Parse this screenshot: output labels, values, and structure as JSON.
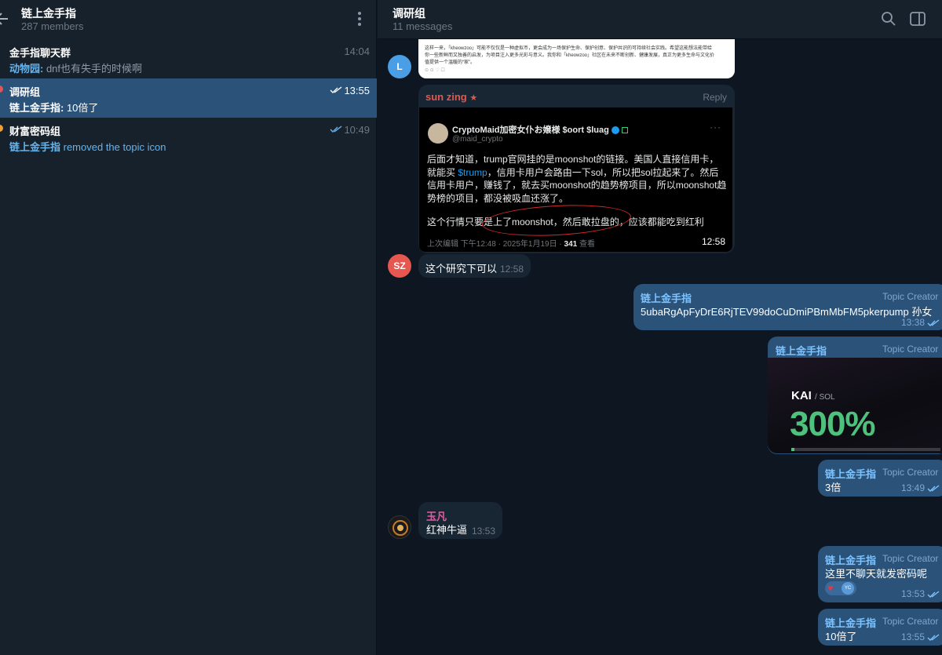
{
  "left": {
    "header": {
      "title": "链上金手指",
      "members": "287 members"
    },
    "topics": [
      {
        "name": "金手指聊天群",
        "sender": "动物园:",
        "message": " dnf也有失手的时候啊",
        "time": "14:04",
        "checks": false,
        "dot": ""
      },
      {
        "name": "调研组",
        "sender": "链上金手指:",
        "message": " 10倍了",
        "time": "13:55",
        "checks": true,
        "dot": "#e05656"
      },
      {
        "name": "财富密码组",
        "sender": "链上金手指",
        "message": " removed the topic icon",
        "time": "10:49",
        "checks": true,
        "dot": "#f0a030"
      }
    ]
  },
  "chat": {
    "header": {
      "title": "调研组",
      "count": "11 messages"
    },
    "top_image": {
      "lines": [
        "这样一来，「kheowzoo」可能不仅仅是一种虚拟币，更会成为一场保护生命、保护创意、保护共识的可持续社会实践。希望这能想法能带给",
        "你一些新鲜而又独善的启发，为项目注入更多光彩与意义。我你和「kheowzoo」社区在未来不断创新、健康发展，真正为更多生命与文化价",
        "值提供一个温暖的“家”。"
      ],
      "avatar": "L"
    },
    "tweet_msg": {
      "sender": "sun zing",
      "reply": "Reply",
      "tweet_author": "CryptoMaid加密女仆お嬢様 $oort $luag",
      "tweet_handle": "@maid_crypto",
      "body_pre": "后面才知道，trump官网挂的是moonshot的链接。美国人直接信用卡，就能买 ",
      "body_link": "$trump",
      "body_post": "，信用卡用户会路由一下sol，所以把sol拉起来了。然后信用卡用户，赚钱了，就去买moonshot的趋势榜项目，所以moonshot趋势榜的项目，都没被吸血还涨了。",
      "body_line2": "这个行情只要是上了moonshot，然后敢拉盘的，应该都能吃到红利",
      "meta_pre": "上次编辑 下午12:48 · 2025年1月19日 · ",
      "meta_views": "341",
      "meta_post": " 查看",
      "time": "12:58"
    },
    "sz_msg": {
      "avatar": "SZ",
      "text": "这个研究下可以",
      "time": "12:58"
    },
    "out1": {
      "sender": "链上金手指",
      "role": "Topic Creator",
      "text": "5ubaRgApFyDrE6RjTEV99doCuDmiPBmMbFM5pkerpump  孙女",
      "time": "13:38"
    },
    "out2": {
      "sender": "链上金手指",
      "role": "Topic Creator",
      "pair": "KAI",
      "pair_quote": "/ SOL",
      "percent": "300%"
    },
    "out3": {
      "sender": "链上金手指",
      "role": "Topic Creator",
      "text": "3倍",
      "time": "13:49"
    },
    "yufan_msg": {
      "sender": "玉凡",
      "text": "红神牛逼",
      "time": "13:53"
    },
    "out4": {
      "sender": "链上金手指",
      "role": "Topic Creator",
      "text": "这里不聊天就发密码呢",
      "reaction": "YC",
      "time": "13:53"
    },
    "out5": {
      "sender": "链上金手指",
      "role": "Topic Creator",
      "text": "10倍了",
      "time": "13:55"
    }
  },
  "colors": {
    "accent": "#2b5278",
    "link": "#64b5ef",
    "sender_red": "#e5574f",
    "sender_pink": "#e85aa0",
    "green": "#4ec27d"
  }
}
